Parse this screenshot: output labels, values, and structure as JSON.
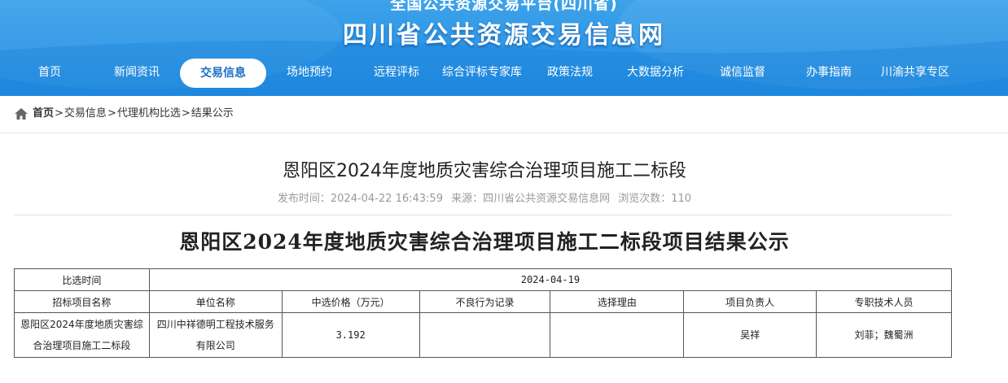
{
  "header": {
    "subtitle": "全国公共资源交易平台(四川省)",
    "title": "四川省公共资源交易信息网",
    "colors": {
      "banner": "#2a94e6",
      "active_text": "#1a6fc6"
    }
  },
  "nav": {
    "items": [
      {
        "label": "首页"
      },
      {
        "label": "新闻资讯"
      },
      {
        "label": "交易信息",
        "active": true
      },
      {
        "label": "场地预约"
      },
      {
        "label": "远程评标"
      },
      {
        "label": "综合评标专家库"
      },
      {
        "label": "政策法规"
      },
      {
        "label": "大数据分析"
      },
      {
        "label": "诚信监督"
      },
      {
        "label": "办事指南"
      },
      {
        "label": "川渝共享专区"
      }
    ]
  },
  "breadcrumb": {
    "icon": "home-icon",
    "items": [
      "首页",
      "交易信息",
      "代理机构比选",
      "结果公示"
    ],
    "separator": ">"
  },
  "article": {
    "title": "恩阳区2024年度地质灾害综合治理项目施工二标段",
    "publish_time": "发布时间：2024-04-22 16:43:59",
    "source": "来源：四川省公共资源交易信息网",
    "views": "浏览次数：110"
  },
  "notice": {
    "title": "恩阳区2024年度地质灾害综合治理项目施工二标段项目结果公示",
    "table": {
      "time_label": "比选时间",
      "time_value": "2024-04-19",
      "headers": [
        "招标项目名称",
        "单位名称",
        "中选价格（万元）",
        "不良行为记录",
        "选择理由",
        "项目负责人",
        "专职技术人员"
      ],
      "rows": [
        [
          "恩阳区2024年度地质灾害综合治理项目施工二标段",
          "四川中祥德明工程技术服务有限公司",
          "3.192",
          "",
          "",
          "吴祥",
          "刘菲；魏蜀洲"
        ]
      ]
    }
  }
}
